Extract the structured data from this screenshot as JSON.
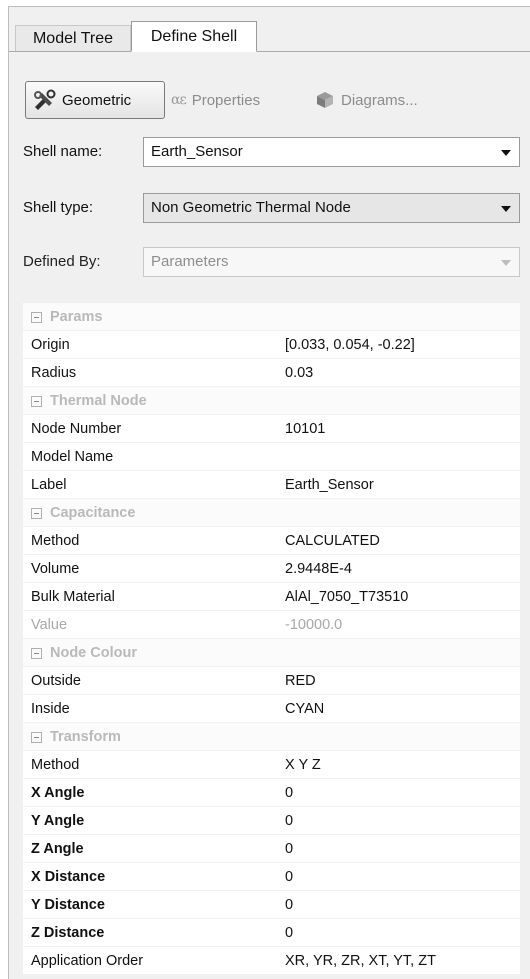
{
  "tabs": [
    {
      "label": "Model Tree",
      "active": false
    },
    {
      "label": "Define Shell",
      "active": true
    }
  ],
  "toolbar": {
    "geometric": {
      "label": "Geometric",
      "icon": "scissors-tools-icon"
    },
    "properties": {
      "label": "Properties",
      "symbol": "αε"
    },
    "diagrams": {
      "label": "Diagrams...",
      "icon": "cube-icon"
    }
  },
  "form": {
    "shell_name": {
      "label": "Shell name:",
      "value": "Earth_Sensor"
    },
    "shell_type": {
      "label": "Shell type:",
      "value": "Non Geometric Thermal Node"
    },
    "defined_by": {
      "label": "Defined By:",
      "value": "Parameters"
    }
  },
  "grid": {
    "params": {
      "title": "Params",
      "rows": [
        {
          "key": "Origin",
          "value": "[0.033, 0.054, -0.22]"
        },
        {
          "key": "Radius",
          "value": "0.03"
        }
      ]
    },
    "thermal_node": {
      "title": "Thermal Node",
      "rows": [
        {
          "key": "Node Number",
          "value": "10101"
        },
        {
          "key": "Model Name",
          "value": ""
        },
        {
          "key": "Label",
          "value": "Earth_Sensor"
        }
      ]
    },
    "capacitance": {
      "title": "Capacitance",
      "rows": [
        {
          "key": "Method",
          "value": "CALCULATED"
        },
        {
          "key": "Volume",
          "value": "2.9448E-4"
        },
        {
          "key": "Bulk Material",
          "value": "AlAl_7050_T73510"
        },
        {
          "key": "Value",
          "value": "-10000.0"
        }
      ]
    },
    "node_colour": {
      "title": "Node Colour",
      "rows": [
        {
          "key": "Outside",
          "value": "RED"
        },
        {
          "key": "Inside",
          "value": "CYAN"
        }
      ]
    },
    "transform": {
      "title": "Transform",
      "rows": [
        {
          "key": "Method",
          "value": "X Y Z"
        },
        {
          "key": "X Angle",
          "value": "0"
        },
        {
          "key": "Y Angle",
          "value": "0"
        },
        {
          "key": "Z Angle",
          "value": "0"
        },
        {
          "key": "X Distance",
          "value": "0"
        },
        {
          "key": "Y Distance",
          "value": "0"
        },
        {
          "key": "Z Distance",
          "value": "0"
        },
        {
          "key": "Application Order",
          "value": "XR, YR, ZR, XT, YT, ZT"
        }
      ]
    }
  },
  "colors": {
    "panel_bg": "#f0f0f0",
    "grid_bg": "#ffffff",
    "section_text": "#b9b9b9",
    "disabled_text": "#8e8e8e"
  }
}
